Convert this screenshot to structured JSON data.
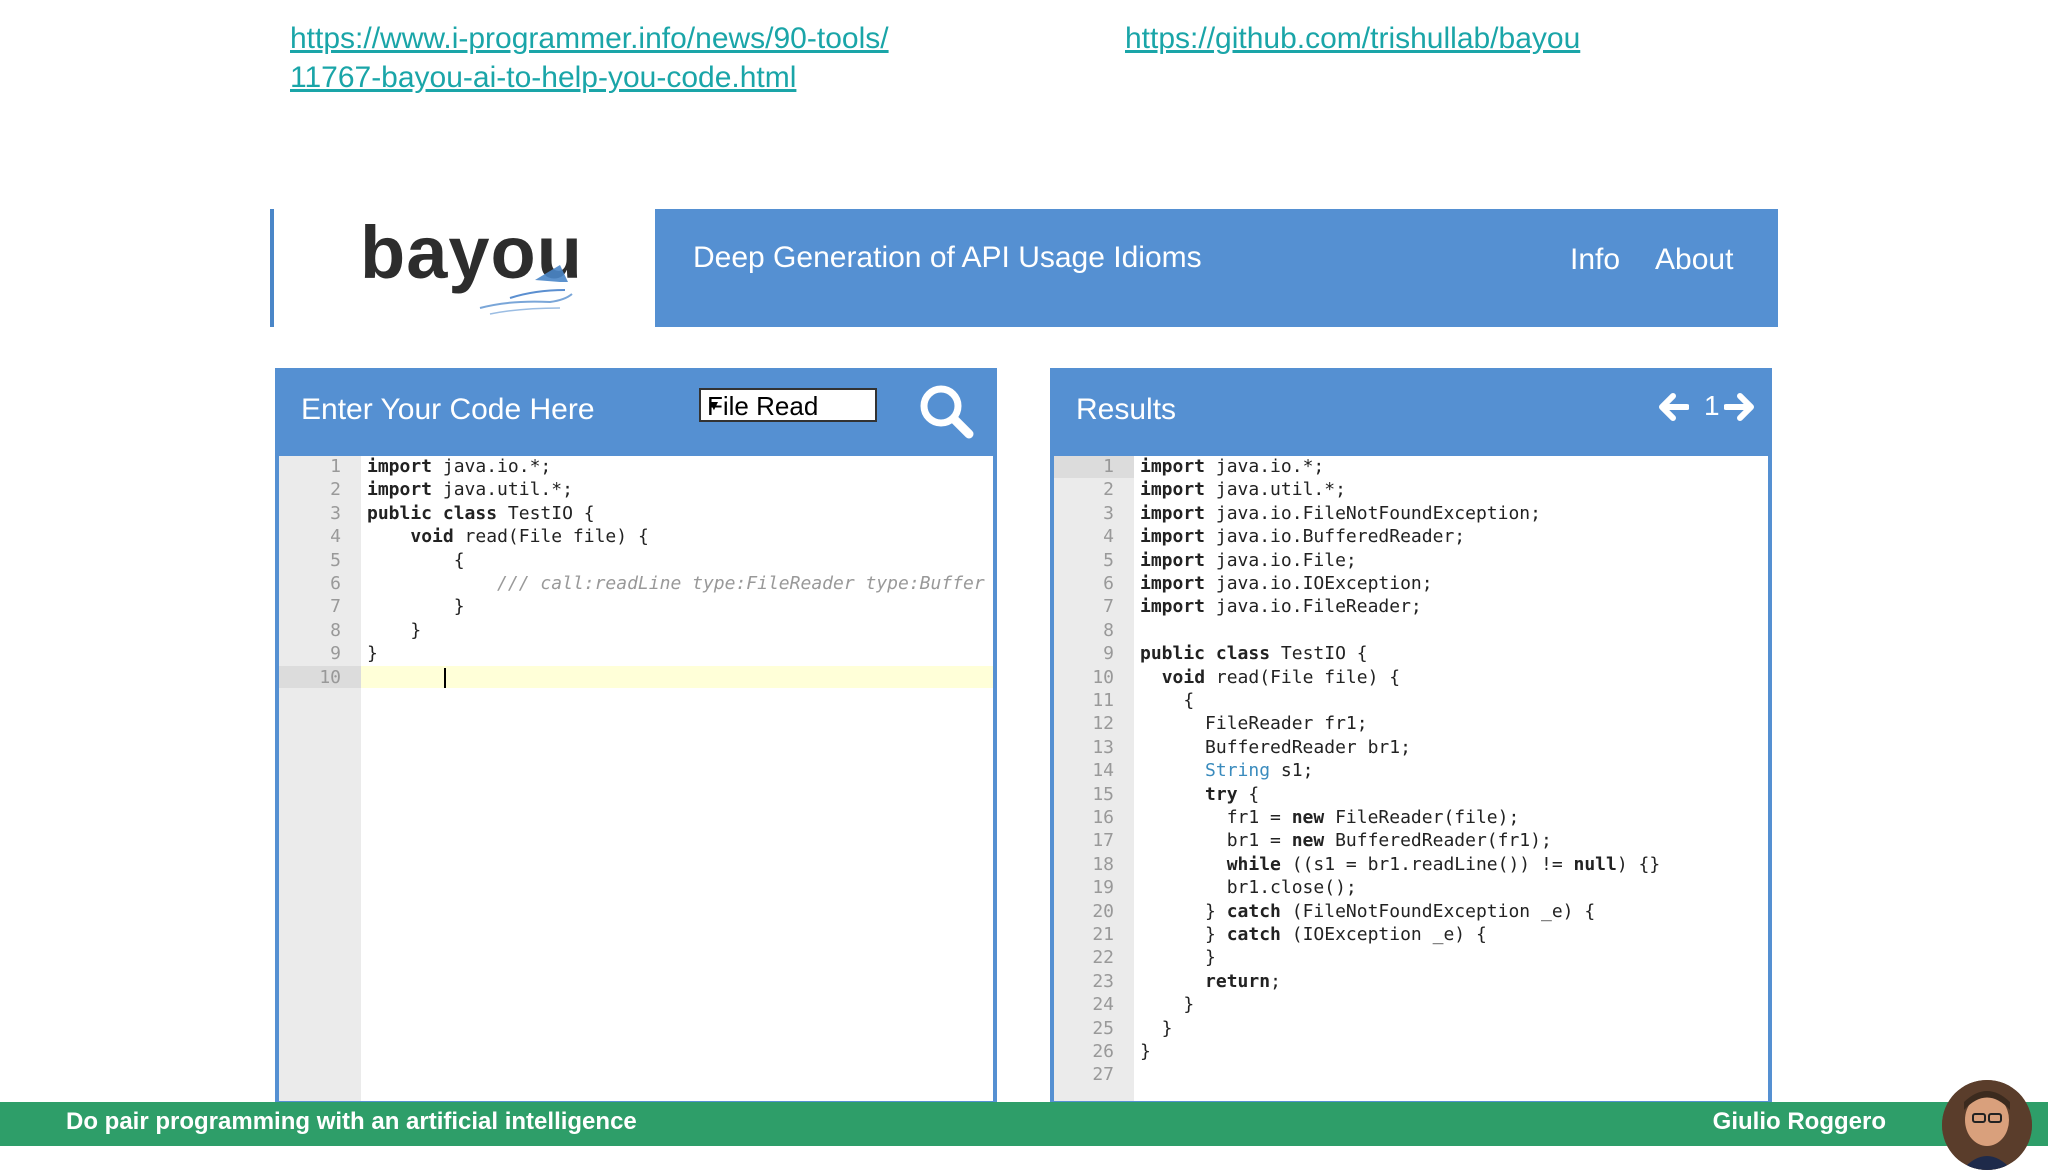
{
  "links": {
    "left_line1": "https://www.i-programmer.info/news/90-tools/",
    "left_line2": "11767-bayou-ai-to-help-you-code.html",
    "right": "https://github.com/trishullab/bayou"
  },
  "logo": {
    "text": "bayou"
  },
  "header": {
    "title": "Deep Generation of API Usage Idioms",
    "nav_info": "Info",
    "nav_about": "About"
  },
  "editor": {
    "title": "Enter Your Code Here",
    "select_value": "File Read",
    "line_numbers": [
      "1",
      "2",
      "3",
      "4",
      "5",
      "6",
      "7",
      "8",
      "9",
      "10"
    ],
    "lines": [
      "import java.io.*;",
      "import java.util.*;",
      "public class TestIO {",
      "    void read(File file) {",
      "        {",
      "            /// call:readLine type:FileReader type:Buffer",
      "        }",
      "    }",
      "}",
      ""
    ]
  },
  "results": {
    "title": "Results",
    "page": "1",
    "line_numbers": [
      "1",
      "2",
      "3",
      "4",
      "5",
      "6",
      "7",
      "8",
      "9",
      "10",
      "11",
      "12",
      "13",
      "14",
      "15",
      "16",
      "17",
      "18",
      "19",
      "20",
      "21",
      "22",
      "23",
      "24",
      "25",
      "26",
      "27"
    ],
    "lines": [
      "import java.io.*;",
      "import java.util.*;",
      "import java.io.FileNotFoundException;",
      "import java.io.BufferedReader;",
      "import java.io.File;",
      "import java.io.IOException;",
      "import java.io.FileReader;",
      "",
      "public class TestIO {",
      "  void read(File file) {",
      "    {",
      "      FileReader fr1;",
      "      BufferedReader br1;",
      "      String s1;",
      "      try {",
      "        fr1 = new FileReader(file);",
      "        br1 = new BufferedReader(fr1);",
      "        while ((s1 = br1.readLine()) != null) {}",
      "        br1.close();",
      "      } catch (FileNotFoundException _e) {",
      "      } catch (IOException _e) {",
      "      }",
      "      return;",
      "    }",
      "  }",
      "}",
      ""
    ]
  },
  "footer": {
    "left": "Do pair programming with an artificial intelligence",
    "right": "Giulio Roggero"
  },
  "colors": {
    "accent": "#5590d2",
    "link": "#1aa5a8",
    "footer": "#2e9e69"
  }
}
